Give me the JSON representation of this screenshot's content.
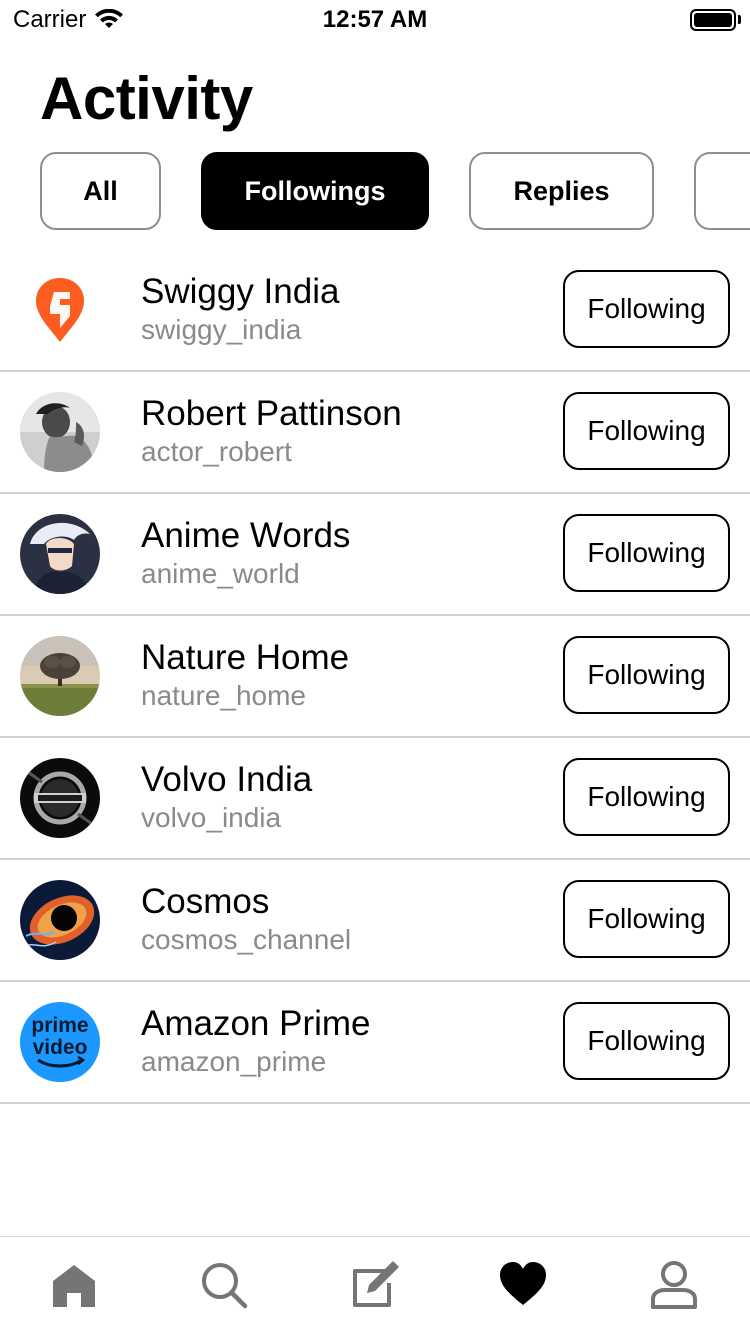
{
  "status_bar": {
    "carrier": "Carrier",
    "time": "12:57 AM",
    "icons": [
      "wifi-icon",
      "battery-icon"
    ]
  },
  "page_title": "Activity",
  "tabs": [
    {
      "label": "All",
      "active": false
    },
    {
      "label": "Followings",
      "active": true
    },
    {
      "label": "Replies",
      "active": false
    },
    {
      "label": "",
      "active": false
    }
  ],
  "accounts": [
    {
      "name": "Swiggy India",
      "handle": "swiggy_india",
      "button": "Following",
      "avatar": "swiggy-logo"
    },
    {
      "name": "Robert Pattinson",
      "handle": "actor_robert",
      "button": "Following",
      "avatar": "person-photo"
    },
    {
      "name": "Anime Words",
      "handle": "anime_world",
      "button": "Following",
      "avatar": "anime-portrait"
    },
    {
      "name": "Nature Home",
      "handle": "nature_home",
      "button": "Following",
      "avatar": "tree-landscape"
    },
    {
      "name": "Volvo India",
      "handle": "volvo_india",
      "button": "Following",
      "avatar": "volvo-grille"
    },
    {
      "name": "Cosmos",
      "handle": "cosmos_channel",
      "button": "Following",
      "avatar": "black-hole"
    },
    {
      "name": "Amazon Prime",
      "handle": "amazon_prime",
      "button": "Following",
      "avatar": "prime-video-logo",
      "logo_text": [
        "prime",
        "video"
      ]
    }
  ],
  "tab_bar": {
    "items": [
      "home-icon",
      "search-icon",
      "compose-icon",
      "heart-icon",
      "profile-icon"
    ],
    "active": "heart-icon",
    "colors": {
      "active": "#000000",
      "inactive": "#757575"
    }
  },
  "colors": {
    "swiggy_orange": "#fc5c1f",
    "prime_blue": "#1a98ff",
    "secondary_text": "#8a8a8a",
    "divider": "#cfcfcf"
  }
}
